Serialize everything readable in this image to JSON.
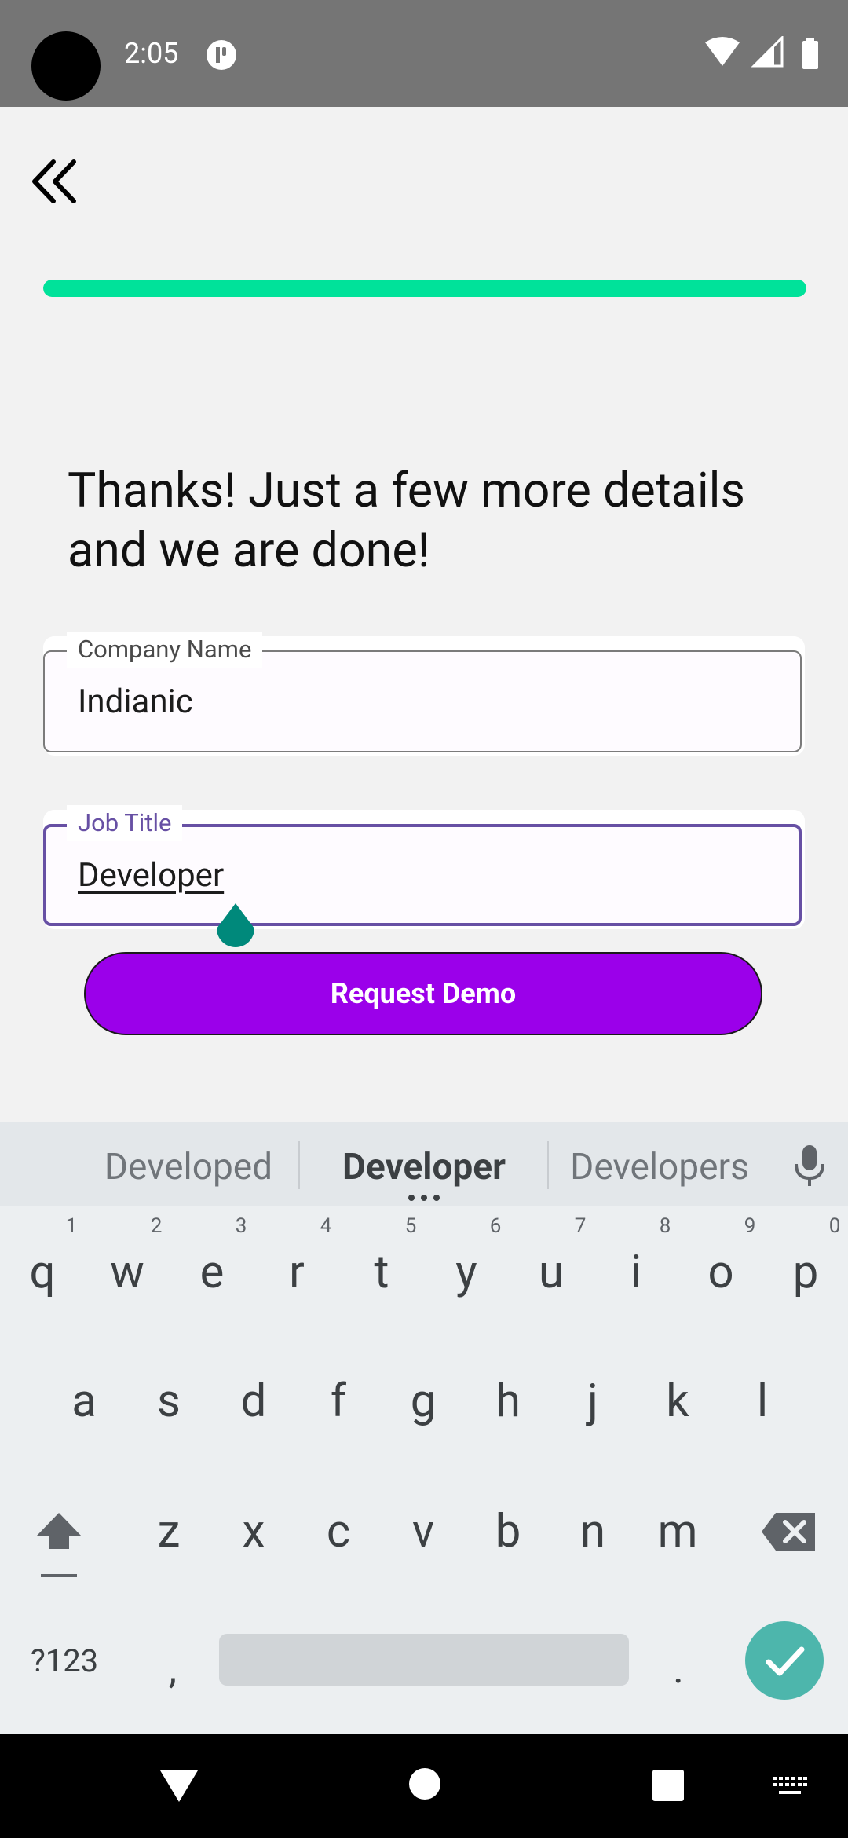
{
  "status_bar": {
    "time": "2:05"
  },
  "progress": {
    "fraction": 1.0,
    "color": "#00e29a"
  },
  "heading": "Thanks! Just a few more details and we are done!",
  "fields": {
    "company": {
      "label": "Company Name",
      "value": "Indianic"
    },
    "job": {
      "label": "Job Title",
      "value": "Developer"
    }
  },
  "request_button": {
    "label": "Request Demo",
    "color": "#9b00ea"
  },
  "keyboard": {
    "suggestions": [
      "Developed",
      "Developer",
      "Developers"
    ],
    "row1": [
      "q",
      "w",
      "e",
      "r",
      "t",
      "y",
      "u",
      "i",
      "o",
      "p"
    ],
    "row1_hints": [
      "1",
      "2",
      "3",
      "4",
      "5",
      "6",
      "7",
      "8",
      "9",
      "0"
    ],
    "row2": [
      "a",
      "s",
      "d",
      "f",
      "g",
      "h",
      "j",
      "k",
      "l"
    ],
    "row3": [
      "z",
      "x",
      "c",
      "v",
      "b",
      "n",
      "m"
    ],
    "symbols_label": "?123",
    "comma": ",",
    "period": "."
  }
}
